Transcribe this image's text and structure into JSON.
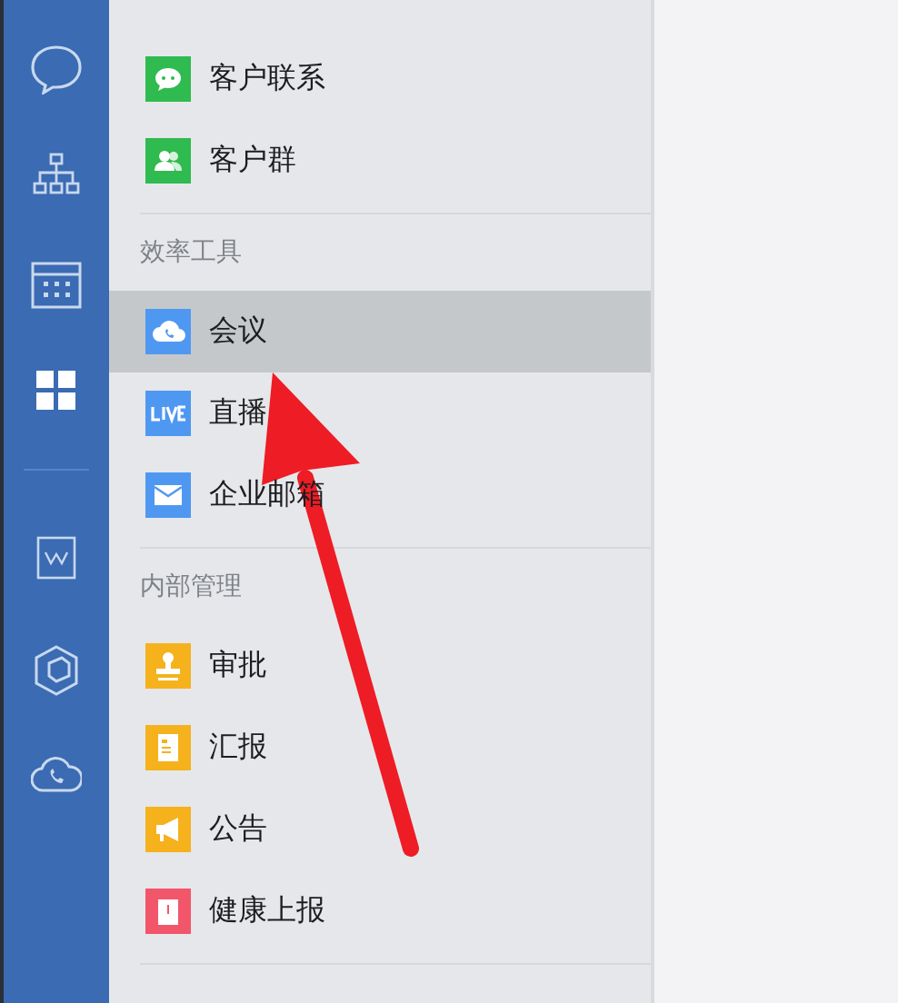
{
  "sidebar": {
    "items": [
      {
        "kind": "chat",
        "selected": false
      },
      {
        "kind": "org",
        "selected": false
      },
      {
        "kind": "calendar",
        "selected": false
      },
      {
        "kind": "apps",
        "selected": true
      },
      {
        "kind": "divider"
      },
      {
        "kind": "doc",
        "selected": false
      },
      {
        "kind": "cube",
        "selected": false
      },
      {
        "kind": "cloudphone",
        "selected": false
      }
    ]
  },
  "sections": [
    {
      "items": [
        {
          "label": "客户联系",
          "kind": "wechat",
          "selected": false
        },
        {
          "label": "客户群",
          "kind": "group",
          "selected": false
        }
      ]
    },
    {
      "title": "效率工具",
      "items": [
        {
          "label": "会议",
          "kind": "meeting",
          "selected": true
        },
        {
          "label": "直播",
          "kind": "live",
          "selected": false
        },
        {
          "label": "企业邮箱",
          "kind": "mail",
          "selected": false
        }
      ]
    },
    {
      "title": "内部管理",
      "items": [
        {
          "label": "审批",
          "kind": "stamp",
          "selected": false
        },
        {
          "label": "汇报",
          "kind": "report",
          "selected": false
        },
        {
          "label": "公告",
          "kind": "notice",
          "selected": false
        },
        {
          "label": "健康上报",
          "kind": "health",
          "selected": false
        }
      ]
    }
  ],
  "annotation": {
    "kind": "arrow"
  }
}
